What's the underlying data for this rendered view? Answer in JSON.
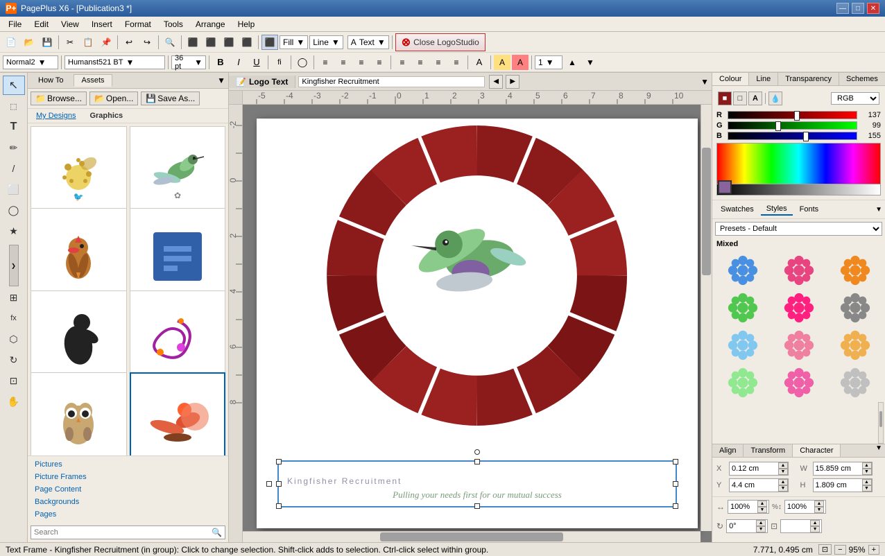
{
  "titleBar": {
    "icon": "P+",
    "title": "PagePlus X6 - [Publication3 *]",
    "buttons": [
      "—",
      "□",
      "✕"
    ]
  },
  "menuBar": {
    "items": [
      "File",
      "Edit",
      "View",
      "Insert",
      "Format",
      "Tools",
      "Arrange",
      "Help"
    ]
  },
  "toolbar1": {
    "buttons": [
      "💾",
      "✂",
      "📋",
      "↩",
      "↪",
      "🔍"
    ]
  },
  "formatBar": {
    "style": "Normal2",
    "font": "Humanst521 BT",
    "size": "36 pt",
    "bold": "B",
    "italic": "I",
    "underline": "U",
    "fill_label": "Fill",
    "line_label": "Line",
    "text_label": "Text",
    "close_logo": "Close LogoStudio"
  },
  "assetsTabs": {
    "howTo": "How To",
    "assets": "Assets"
  },
  "assetsActions": {
    "browse": "Browse...",
    "open": "Open...",
    "saveAs": "Save As..."
  },
  "assetsNav": {
    "myDesigns": "My Designs",
    "graphics": "Graphics"
  },
  "assetCategories": {
    "pictures": "Pictures",
    "pictureFrames": "Picture Frames",
    "pageContent": "Page Content",
    "backgrounds": "Backgrounds",
    "pages": "Pages"
  },
  "searchBar": {
    "placeholder": "Search",
    "button": "🔍"
  },
  "canvasHeader": {
    "logoTextTab": "Logo Text",
    "textContent": "Kingfisher Recruitment"
  },
  "logoText": {
    "mainText": "Kingfisher Recruitment",
    "subText": "Pulling your needs first for our mutual success"
  },
  "rightPanel": {
    "colourTab": "Colour",
    "lineTab": "Line",
    "transparencyTab": "Transparency",
    "schemesTab": "Schemes",
    "rgbLabel": "RGB",
    "rLabel": "R",
    "gLabel": "G",
    "bLabel": "B",
    "rValue": "137",
    "gValue": "99",
    "bValue": "155"
  },
  "swatchesTabs": {
    "swatches": "Swatches",
    "styles": "Styles",
    "fonts": "Fonts"
  },
  "swatchesPreset": {
    "label": "Presets - Default",
    "category": "Mixed"
  },
  "bottomTabs": {
    "align": "Align",
    "transform": "Transform",
    "character": "Character"
  },
  "transformFields": {
    "xLabel": "X",
    "yLabel": "Y",
    "wLabel": "W",
    "hLabel": "H",
    "xValue": "0.12 cm",
    "yValue": "4.4 cm",
    "wValue": "15.859 cm",
    "hValue": "1.809 cm",
    "scaleW": "100%",
    "scaleH": "100%",
    "rotateLabel": "0°"
  },
  "statusBar": {
    "mainText": "Text Frame - Kingfisher Recruitment (in group): Click to change selection. Shift-click adds to selection. Ctrl-click select within group.",
    "coords": "7.771, 0.495 cm",
    "zoom": "95%"
  },
  "sidebarTools": [
    "↖",
    "⬚",
    "T",
    "✏",
    "/",
    "⬜",
    "◯",
    "★",
    "⊞",
    "fx",
    "❯"
  ],
  "rulerMarks": [
    "-5",
    "-4",
    "-3",
    "-2",
    "-1",
    "0",
    "1",
    "2",
    "3",
    "4",
    "5",
    "6",
    "7",
    "8",
    "9",
    "10"
  ]
}
